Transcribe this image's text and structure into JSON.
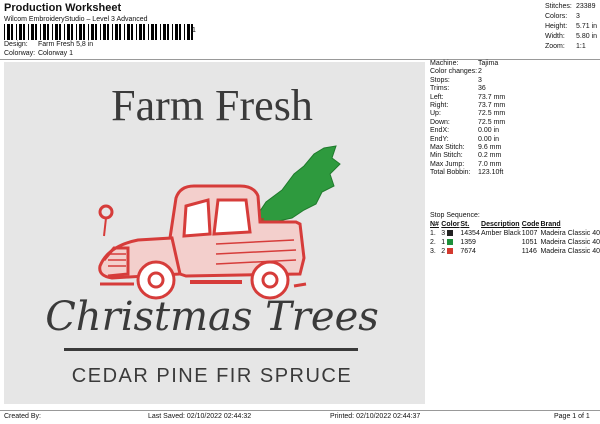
{
  "header": {
    "title": "Production Worksheet",
    "subtitle": "Wilcom EmbroideryStudio – Level 3 Advanced",
    "barcode_number": "1"
  },
  "design": {
    "design_label": "Design:",
    "design_value": "Farm Fresh 5,8 in",
    "colorway_label": "Colorway:",
    "colorway_value": "Colorway 1"
  },
  "top_stats": [
    {
      "label": "Stitches:",
      "value": "23389"
    },
    {
      "label": "Colors:",
      "value": "3"
    },
    {
      "label": "Height:",
      "value": "5.71 in"
    },
    {
      "label": "Width:",
      "value": "5.80 in"
    },
    {
      "label": "Zoom:",
      "value": "1:1"
    }
  ],
  "artwork": {
    "line1": "Farm Fresh",
    "line2": "Christmas Trees",
    "line3": "CEDAR PINE FIR SPRUCE",
    "thread_black": "#3a3a3a",
    "thread_red": "#d63c3a",
    "thread_green": "#2e9a3e"
  },
  "machine_stats": [
    {
      "label": "Machine:",
      "value": "Tajima"
    },
    {
      "label": "Color changes:",
      "value": "2"
    },
    {
      "label": "Stops:",
      "value": "3"
    },
    {
      "label": "Trims:",
      "value": "36"
    },
    {
      "label": "Left:",
      "value": "73.7 mm"
    },
    {
      "label": "Right:",
      "value": "73.7 mm"
    },
    {
      "label": "Up:",
      "value": "72.5 mm"
    },
    {
      "label": "Down:",
      "value": "72.5 mm"
    },
    {
      "label": "EndX:",
      "value": "0.00 in"
    },
    {
      "label": "EndY:",
      "value": "0.00 in"
    },
    {
      "label": "Max Stitch:",
      "value": "9.6 mm"
    },
    {
      "label": "Min Stitch:",
      "value": "0.2 mm"
    },
    {
      "label": "Max Jump:",
      "value": "7.0 mm"
    },
    {
      "label": "Total Bobbin:",
      "value": "123.10ft"
    }
  ],
  "stop_sequence": {
    "label": "Stop Sequence:",
    "headers": {
      "n": "N#",
      "color": "Color",
      "st": "St.",
      "description": "Description",
      "code": "Code",
      "brand": "Brand"
    },
    "rows": [
      {
        "n": "1.",
        "color_index": "3",
        "swatch": "#222222",
        "st": "14354",
        "description": "Amber Black",
        "code": "1007",
        "brand": "Madeira Classic 40"
      },
      {
        "n": "2.",
        "color_index": "1",
        "swatch": "#1e8f3a",
        "st": "1359",
        "description": "",
        "code": "1051",
        "brand": "Madeira Classic 40"
      },
      {
        "n": "3.",
        "color_index": "2",
        "swatch": "#d33a2f",
        "st": "7674",
        "description": "",
        "code": "1146",
        "brand": "Madeira Classic 40"
      }
    ]
  },
  "footer": {
    "created_by": "Created By:",
    "last_saved": "Last Saved: 02/10/2022 02:44:32",
    "printed": "Printed: 02/10/2022 02:44:37",
    "page": "Page 1 of 1"
  }
}
